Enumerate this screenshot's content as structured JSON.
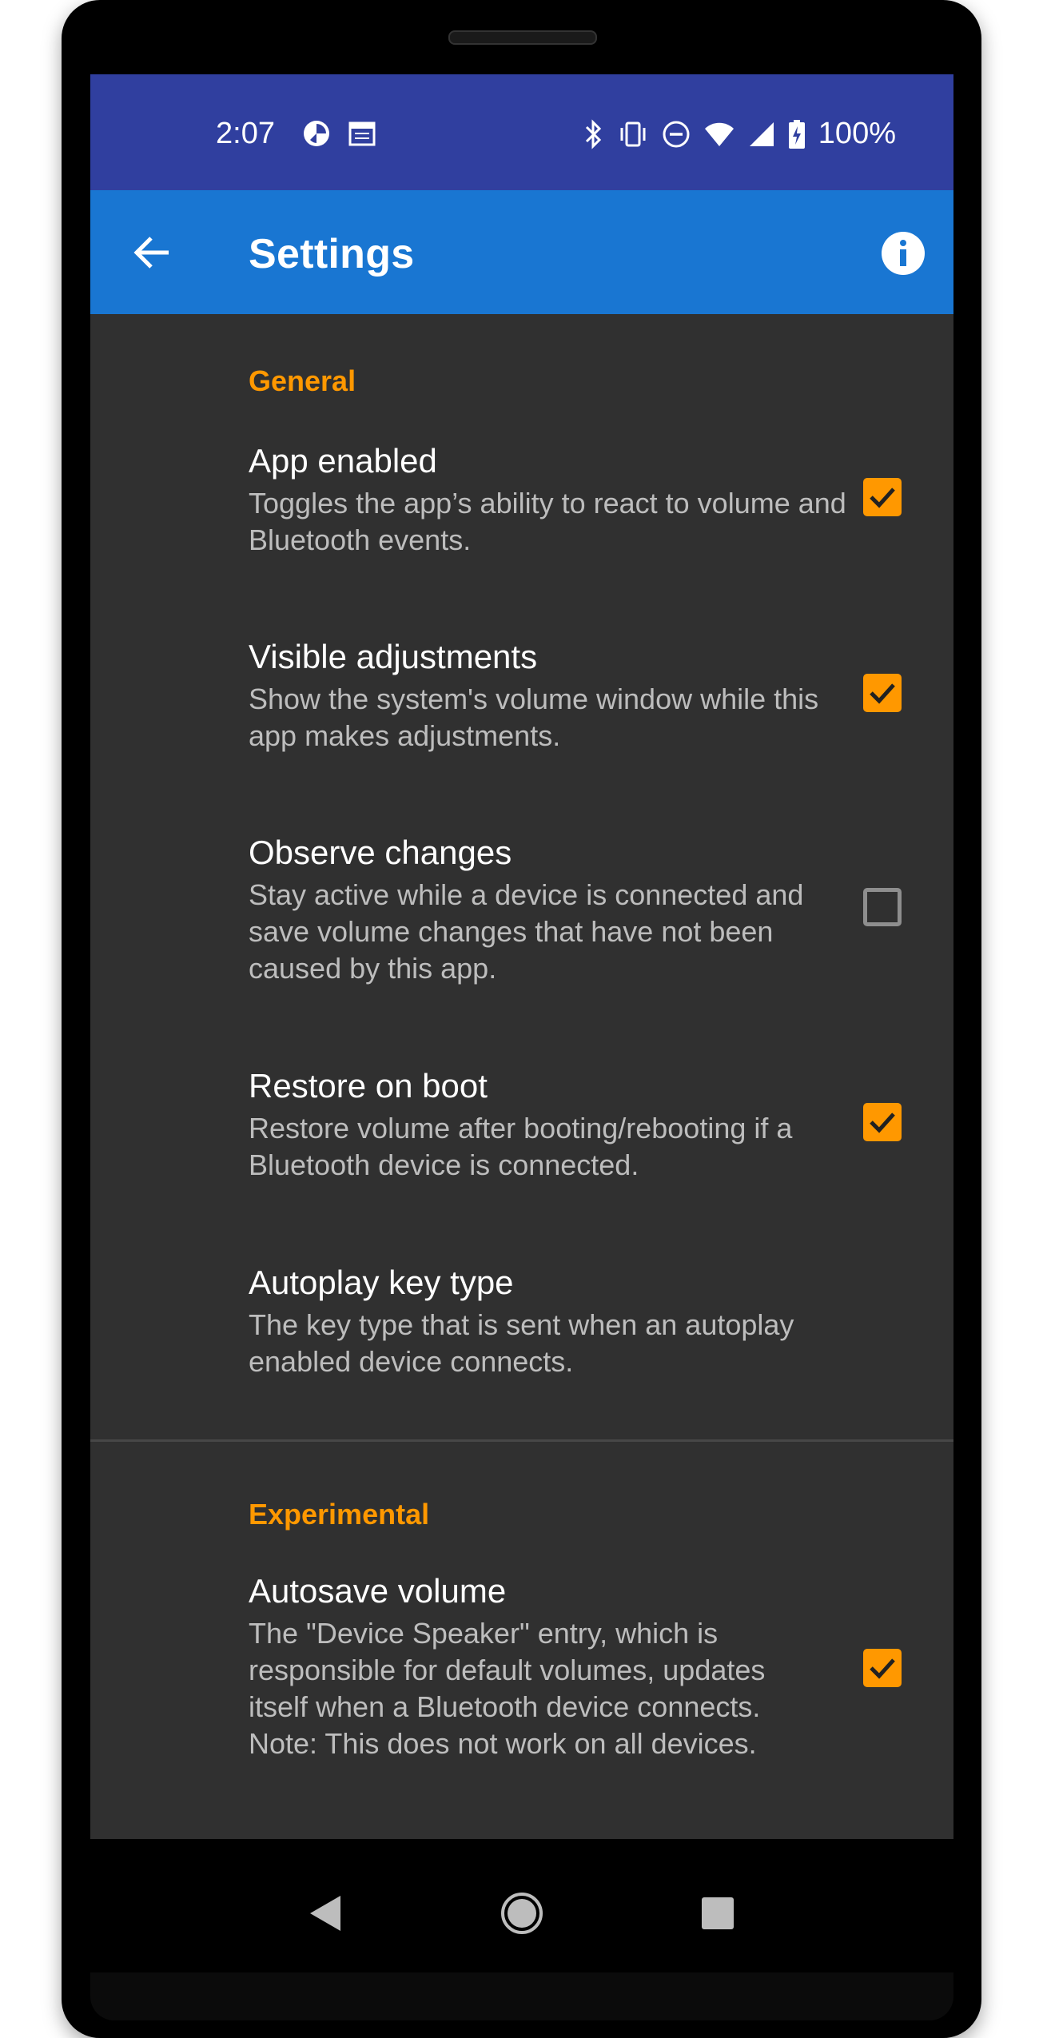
{
  "status_bar": {
    "time": "2:07",
    "battery_percent": "100%",
    "left_icons": [
      "pinwheel-icon",
      "calendar-icon"
    ],
    "right_icons": [
      "bluetooth-icon",
      "vibrate-icon",
      "do-not-disturb-icon",
      "wifi-icon",
      "signal-icon",
      "battery-charging-icon"
    ]
  },
  "app_bar": {
    "title": "Settings",
    "back_icon": "arrow-back-icon",
    "info_icon": "info-icon"
  },
  "sections": [
    {
      "header": "General",
      "prefs": [
        {
          "title": "App enabled",
          "summary": "Toggles the app’s ability to react to volume and Bluetooth events.",
          "checked": true
        },
        {
          "title": "Visible adjustments",
          "summary": "Show the system's volume window while this app makes adjustments.",
          "checked": true
        },
        {
          "title": "Observe changes",
          "summary": "Stay active while a device is connected and save volume changes that have not been caused by this app.",
          "checked": false
        },
        {
          "title": "Restore on boot",
          "summary": "Restore volume after booting/rebooting if a Bluetooth device is connected.",
          "checked": true
        },
        {
          "title": "Autoplay key type",
          "summary": "The key type that is sent when an autoplay enabled device connects."
        }
      ]
    },
    {
      "header": "Experimental",
      "prefs": [
        {
          "title": "Autosave volume",
          "summary": "The \"Device Speaker\" entry, which is responsible for default volumes, updates itself when a Bluetooth device connects. Note: This does not work on all devices.",
          "checked": true
        }
      ]
    }
  ],
  "nav_bar": {
    "icons": [
      "nav-back-icon",
      "nav-home-icon",
      "nav-recents-icon"
    ]
  },
  "colors": {
    "accent": "#ff9800",
    "status_bar": "#303f9f",
    "app_bar": "#1976d2",
    "background": "#303030"
  }
}
